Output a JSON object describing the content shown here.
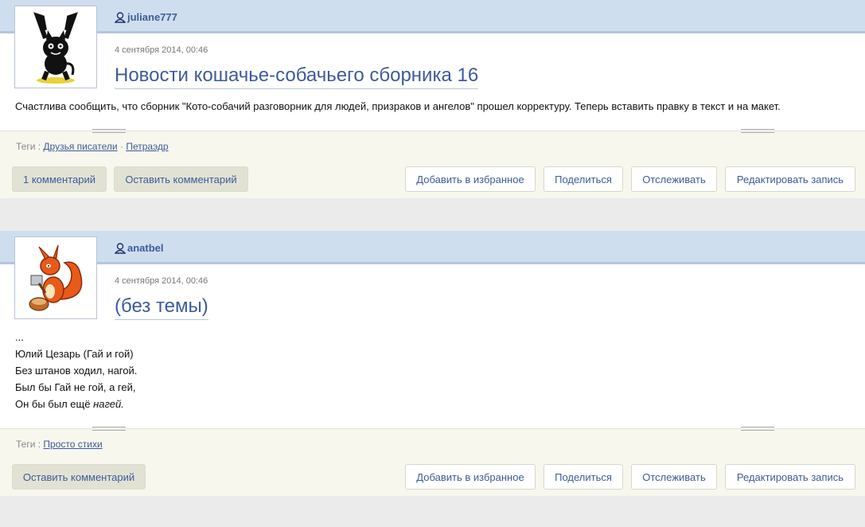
{
  "entries": [
    {
      "username": "juliane777",
      "date": "4 сентября 2014, 00:46",
      "title": "Новости кошачье-собачьего сборника 16",
      "body": [
        "Счастлива сообщить, что сборник \"Кото-собачий разговорник для людей, призраков и ангелов\" прошел корректуру. Теперь вставить правку в текст и на макет."
      ],
      "tags_label": "Теги :",
      "tags": [
        "Друзья писатели",
        "Петраэдр"
      ],
      "tag_sep": "·",
      "buttons": {
        "comments": "1 комментарий",
        "leave_comment": "Оставить комментарий",
        "favorite": "Добавить в избранное",
        "share": "Поделиться",
        "track": "Отслеживать",
        "edit": "Редактировать запись"
      },
      "avatar_icon": "black-cat-avatar"
    },
    {
      "username": "anatbel",
      "date": "4 сентября 2014, 00:46",
      "title": "(без темы)",
      "body": [
        "...",
        "Юлий Цезарь (Гай и гой)",
        "Без штанов ходил, нагой.",
        "Был бы Гай не гой, а гей,",
        "Он бы был ещё ",
        "нагей."
      ],
      "tags_label": "Теги :",
      "tags": [
        "Просто стихи"
      ],
      "buttons": {
        "leave_comment": "Оставить комментарий",
        "favorite": "Добавить в избранное",
        "share": "Поделиться",
        "track": "Отслеживать",
        "edit": "Редактировать запись"
      },
      "avatar_icon": "squirrel-avatar"
    }
  ],
  "colors": {
    "header_bg": "#cfdeef",
    "link": "#3d5c99",
    "footer_bg": "#f7f7ee",
    "page_bg": "#ebebeb"
  }
}
